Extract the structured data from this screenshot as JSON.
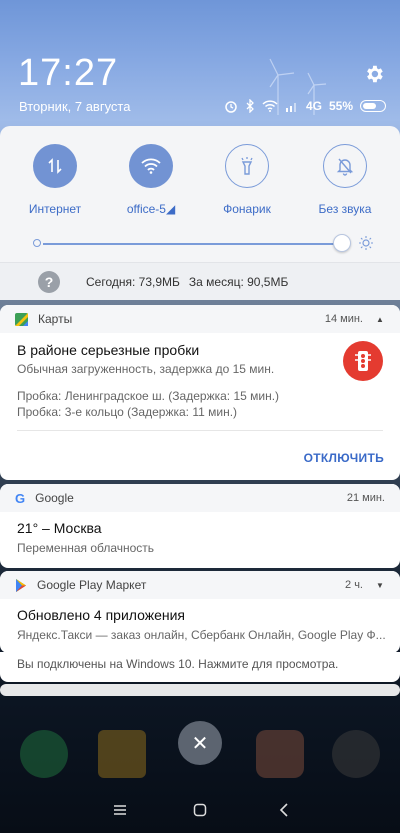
{
  "header": {
    "time": "17:27",
    "date": "Вторник, 7 августа",
    "network": "4G",
    "battery": "55%"
  },
  "quick_settings": {
    "tiles": [
      {
        "label": "Интернет",
        "state": "on",
        "icon": "data-arrows-icon"
      },
      {
        "label": "office-5◢",
        "state": "on",
        "icon": "wifi-icon"
      },
      {
        "label": "Фонарик",
        "state": "off",
        "icon": "flashlight-icon"
      },
      {
        "label": "Без звука",
        "state": "off",
        "icon": "bell-off-icon"
      }
    ],
    "brightness_level": 0.9,
    "data_today": "Сегодня: 73,9МБ",
    "data_month": "За месяц: 90,5МБ"
  },
  "notifications": {
    "maps": {
      "app": "Карты",
      "time": "14 мин.",
      "title": "В районе серьезные пробки",
      "subtitle": "Обычная загруженность, задержка до 15 мин.",
      "line1": "Пробка: Ленинградское ш. (Задержка: 15 мин.)",
      "line2": "Пробка: 3-е кольцо (Задержка: 11 мин.)",
      "action": "ОТКЛЮЧИТЬ"
    },
    "google": {
      "app": "Google",
      "time": "21 мин.",
      "title": "21° – Москва",
      "subtitle": "Переменная облачность"
    },
    "play": {
      "app": "Google Play Маркет",
      "time": "2 ч.",
      "title": "Обновлено 4 приложения",
      "subtitle": "Яндекс.Такси — заказ онлайн, Сбербанк Онлайн, Google Play Ф..."
    },
    "windows": {
      "text": "Вы подключены на Windows 10. Нажмите для просмотра."
    }
  },
  "close_label": "✕",
  "colors": {
    "accent": "#7293d3",
    "link": "#3a6ac8",
    "maps_red": "#e43b30"
  }
}
